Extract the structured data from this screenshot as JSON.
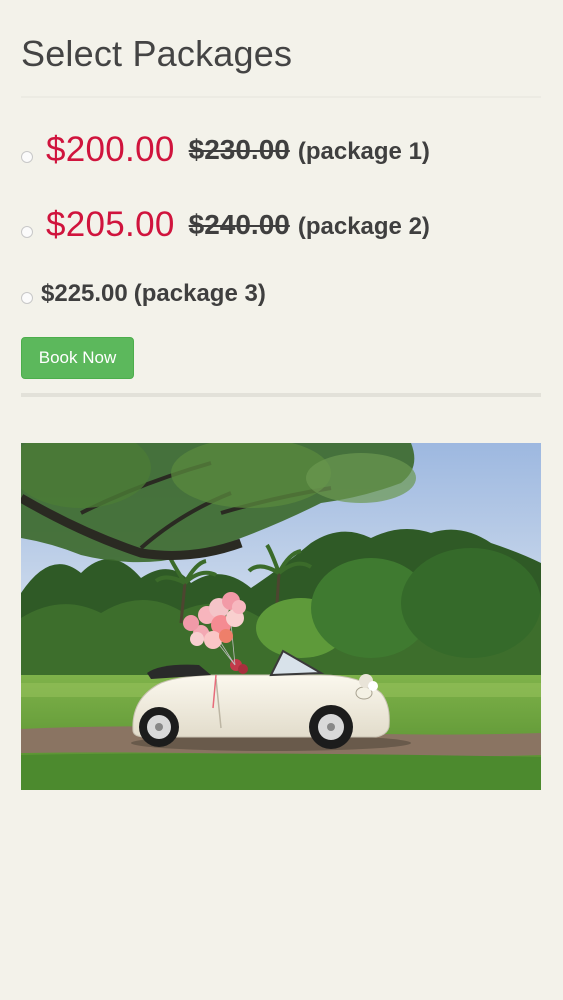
{
  "title": "Select Packages",
  "packages": [
    {
      "sale_price": "$200.00",
      "regular_price": "$230.00",
      "name": "(package 1)"
    },
    {
      "sale_price": "$205.00",
      "regular_price": "$240.00",
      "name": "(package 2)"
    },
    {
      "price": "$225.00",
      "name": "(package 3)"
    }
  ],
  "book_button": {
    "label": "Book Now"
  },
  "colors": {
    "background": "#f3f2ea",
    "sale_price": "#d0143d",
    "button": "#5cb85c",
    "text": "#3f3f3f"
  }
}
